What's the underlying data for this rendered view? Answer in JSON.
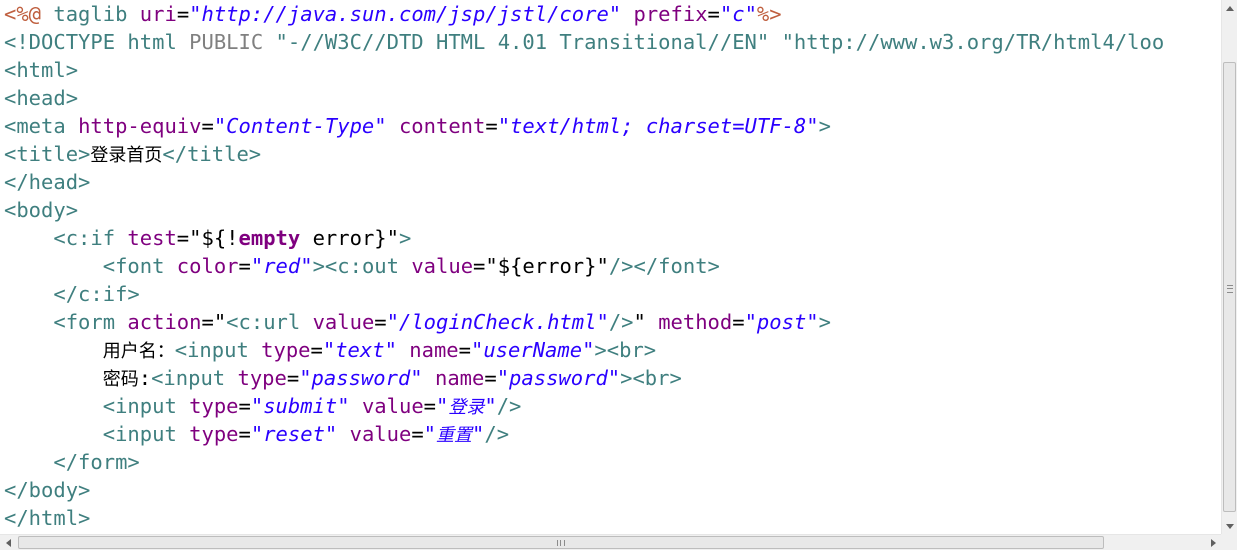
{
  "colors": {
    "background": "#ffffff",
    "directive": "#bf5f3f",
    "tag": "#3f7f7f",
    "attribute": "#7f007f",
    "value": "#2a00ff",
    "text": "#000000",
    "doctype_keyword": "#808080"
  },
  "editor": {
    "lines": [
      [
        {
          "t": "<%@",
          "c": "directive"
        },
        {
          "t": " taglib ",
          "c": "tag"
        },
        {
          "t": "uri",
          "c": "attribute"
        },
        {
          "t": "=",
          "c": "text"
        },
        {
          "t": "\"http://java.sun.com/jsp/jstl/core\"",
          "c": "value",
          "i": true
        },
        {
          "t": " ",
          "c": "text"
        },
        {
          "t": "prefix",
          "c": "attribute"
        },
        {
          "t": "=",
          "c": "text"
        },
        {
          "t": "\"c\"",
          "c": "value",
          "i": true
        },
        {
          "t": "%>",
          "c": "directive"
        }
      ],
      [
        {
          "t": "<!DOCTYPE ",
          "c": "tag"
        },
        {
          "t": "html ",
          "c": "tag"
        },
        {
          "t": "PUBLIC ",
          "c": "doctype_keyword"
        },
        {
          "t": "\"-//W3C//DTD HTML 4.01 Transitional//EN\" ",
          "c": "tag"
        },
        {
          "t": "\"http://www.w3.org/TR/html4/loo",
          "c": "tag"
        }
      ],
      [
        {
          "t": "<html>",
          "c": "tag"
        }
      ],
      [
        {
          "t": "<head>",
          "c": "tag"
        }
      ],
      [
        {
          "t": "<meta ",
          "c": "tag"
        },
        {
          "t": "http-equiv",
          "c": "attribute"
        },
        {
          "t": "=",
          "c": "text"
        },
        {
          "t": "\"Content-Type\"",
          "c": "value",
          "i": true
        },
        {
          "t": " ",
          "c": "text"
        },
        {
          "t": "content",
          "c": "attribute"
        },
        {
          "t": "=",
          "c": "text"
        },
        {
          "t": "\"text/html; charset=UTF-8\"",
          "c": "value",
          "i": true
        },
        {
          "t": ">",
          "c": "tag"
        }
      ],
      [
        {
          "t": "<title>",
          "c": "tag"
        },
        {
          "t": "登录首页",
          "c": "text",
          "cjk": true
        },
        {
          "t": "</title>",
          "c": "tag"
        }
      ],
      [
        {
          "t": "</head>",
          "c": "tag"
        }
      ],
      [
        {
          "t": "<body>",
          "c": "tag"
        }
      ],
      [
        {
          "t": "    <c:if ",
          "c": "tag"
        },
        {
          "t": "test",
          "c": "attribute"
        },
        {
          "t": "=",
          "c": "text"
        },
        {
          "t": "\"${!",
          "c": "text"
        },
        {
          "t": "empty",
          "c": "attribute",
          "b": true
        },
        {
          "t": " error}\"",
          "c": "text"
        },
        {
          "t": ">",
          "c": "tag"
        }
      ],
      [
        {
          "t": "        <font ",
          "c": "tag"
        },
        {
          "t": "color",
          "c": "attribute"
        },
        {
          "t": "=",
          "c": "text"
        },
        {
          "t": "\"red\"",
          "c": "value",
          "i": true
        },
        {
          "t": "><c:out ",
          "c": "tag"
        },
        {
          "t": "value",
          "c": "attribute"
        },
        {
          "t": "=",
          "c": "text"
        },
        {
          "t": "\"${error}\"",
          "c": "text"
        },
        {
          "t": "/></font>",
          "c": "tag"
        }
      ],
      [
        {
          "t": "    </c:if>",
          "c": "tag"
        }
      ],
      [
        {
          "t": "    <form ",
          "c": "tag"
        },
        {
          "t": "action",
          "c": "attribute"
        },
        {
          "t": "=",
          "c": "text"
        },
        {
          "t": "\"",
          "c": "text"
        },
        {
          "t": "<c:url ",
          "c": "tag"
        },
        {
          "t": "value",
          "c": "attribute"
        },
        {
          "t": "=",
          "c": "text"
        },
        {
          "t": "\"/loginCheck.html\"",
          "c": "value",
          "i": true
        },
        {
          "t": "/>",
          "c": "tag"
        },
        {
          "t": "\" ",
          "c": "text"
        },
        {
          "t": "method",
          "c": "attribute"
        },
        {
          "t": "=",
          "c": "text"
        },
        {
          "t": "\"post\"",
          "c": "value",
          "i": true
        },
        {
          "t": ">",
          "c": "tag"
        }
      ],
      [
        {
          "t": "        ",
          "c": "text"
        },
        {
          "t": "用户名：",
          "c": "text",
          "cjk": true
        },
        {
          "t": "<input ",
          "c": "tag"
        },
        {
          "t": "type",
          "c": "attribute"
        },
        {
          "t": "=",
          "c": "text"
        },
        {
          "t": "\"text\"",
          "c": "value",
          "i": true
        },
        {
          "t": " ",
          "c": "text"
        },
        {
          "t": "name",
          "c": "attribute"
        },
        {
          "t": "=",
          "c": "text"
        },
        {
          "t": "\"userName\"",
          "c": "value",
          "i": true
        },
        {
          "t": "><br>",
          "c": "tag"
        }
      ],
      [
        {
          "t": "        ",
          "c": "text"
        },
        {
          "t": "密码",
          "c": "text",
          "cjk": true
        },
        {
          "t": ":",
          "c": "text"
        },
        {
          "t": "<input ",
          "c": "tag"
        },
        {
          "t": "type",
          "c": "attribute"
        },
        {
          "t": "=",
          "c": "text"
        },
        {
          "t": "\"password\"",
          "c": "value",
          "i": true
        },
        {
          "t": " ",
          "c": "text"
        },
        {
          "t": "name",
          "c": "attribute"
        },
        {
          "t": "=",
          "c": "text"
        },
        {
          "t": "\"password\"",
          "c": "value",
          "i": true
        },
        {
          "t": "><br>",
          "c": "tag"
        }
      ],
      [
        {
          "t": "        <input ",
          "c": "tag"
        },
        {
          "t": "type",
          "c": "attribute"
        },
        {
          "t": "=",
          "c": "text"
        },
        {
          "t": "\"submit\"",
          "c": "value",
          "i": true
        },
        {
          "t": " ",
          "c": "text"
        },
        {
          "t": "value",
          "c": "attribute"
        },
        {
          "t": "=",
          "c": "text"
        },
        {
          "t": "\"",
          "c": "value",
          "i": true
        },
        {
          "t": "登录",
          "c": "value",
          "i": true,
          "cjk": true
        },
        {
          "t": "\"",
          "c": "value",
          "i": true
        },
        {
          "t": "/>",
          "c": "tag"
        }
      ],
      [
        {
          "t": "        <input ",
          "c": "tag"
        },
        {
          "t": "type",
          "c": "attribute"
        },
        {
          "t": "=",
          "c": "text"
        },
        {
          "t": "\"reset\"",
          "c": "value",
          "i": true
        },
        {
          "t": " ",
          "c": "text"
        },
        {
          "t": "value",
          "c": "attribute"
        },
        {
          "t": "=",
          "c": "text"
        },
        {
          "t": "\"",
          "c": "value",
          "i": true
        },
        {
          "t": "重置",
          "c": "value",
          "i": true,
          "cjk": true
        },
        {
          "t": "\"",
          "c": "value",
          "i": true
        },
        {
          "t": "/>",
          "c": "tag"
        }
      ],
      [
        {
          "t": "    </form>",
          "c": "tag"
        }
      ],
      [
        {
          "t": "</body>",
          "c": "tag"
        }
      ],
      [
        {
          "t": "</html>",
          "c": "tag"
        }
      ]
    ]
  },
  "scrollbars": {
    "vertical": {
      "up_icon": "arrow-up-icon",
      "down_icon": "arrow-down-icon"
    },
    "horizontal": {
      "left_icon": "arrow-left-icon",
      "right_icon": "arrow-right-icon"
    }
  }
}
